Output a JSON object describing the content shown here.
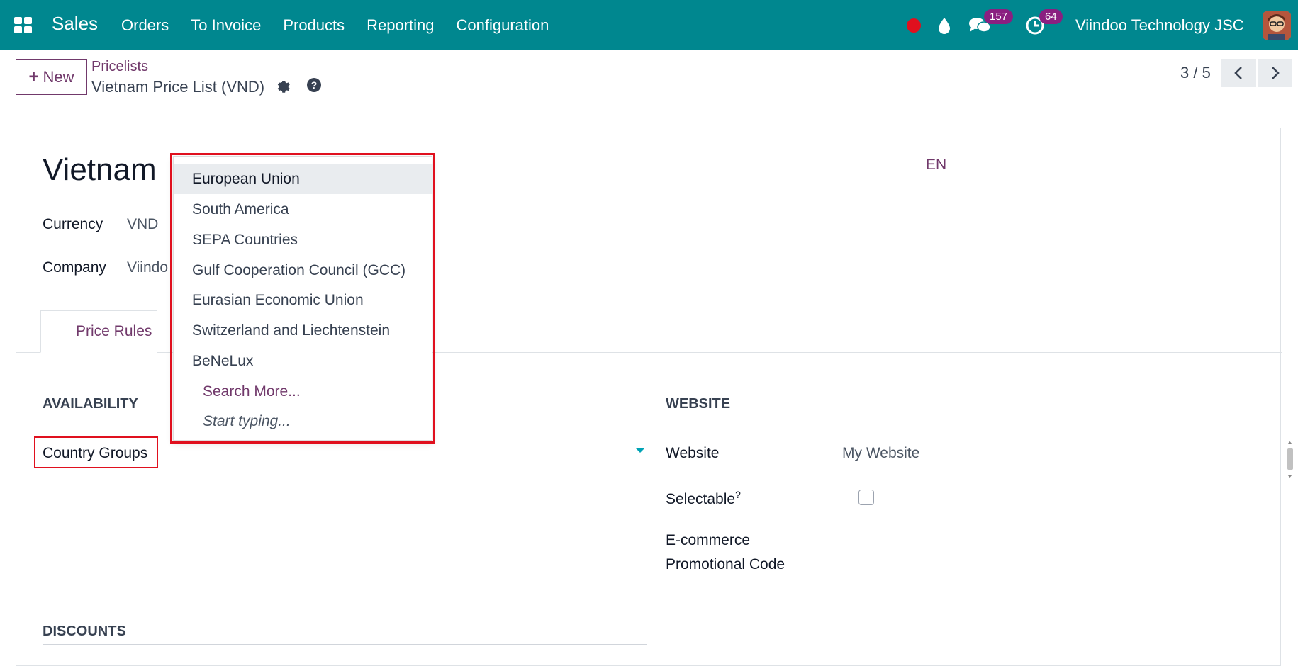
{
  "navbar": {
    "app_name": "Sales",
    "menu": [
      "Orders",
      "To Invoice",
      "Products",
      "Reporting",
      "Configuration"
    ],
    "messages_count": "157",
    "activities_count": "64",
    "company": "Viindoo Technology JSC"
  },
  "control": {
    "new_label": "New",
    "breadcrumb_parent": "Pricelists",
    "breadcrumb_current": "Vietnam Price List (VND)",
    "pager": "3 / 5"
  },
  "record": {
    "title": "Vietnam",
    "lang": "EN",
    "currency_label": "Currency",
    "currency_value": "VND",
    "company_label": "Company",
    "company_value": "Viindo",
    "tab_price_rules": "Price Rules"
  },
  "availability": {
    "title": "AVAILABILITY",
    "country_groups_label": "Country Groups"
  },
  "website": {
    "title": "WEBSITE",
    "website_label": "Website",
    "website_value": "My Website",
    "selectable_label": "Selectable",
    "selectable_help": "?",
    "ecom_label_1": "E-commerce",
    "ecom_label_2": "Promotional Code"
  },
  "discounts": {
    "title": "DISCOUNTS"
  },
  "dropdown": {
    "items": [
      "European Union",
      "South America",
      "SEPA Countries",
      "Gulf Cooperation Council (GCC)",
      "Eurasian Economic Union",
      "Switzerland and Liechtenstein",
      "BeNeLux"
    ],
    "search_more": "Search More...",
    "start_typing": "Start typing..."
  },
  "colors": {
    "navbar": "#00878f",
    "accent": "#71396b",
    "highlight": "#e0101e"
  }
}
